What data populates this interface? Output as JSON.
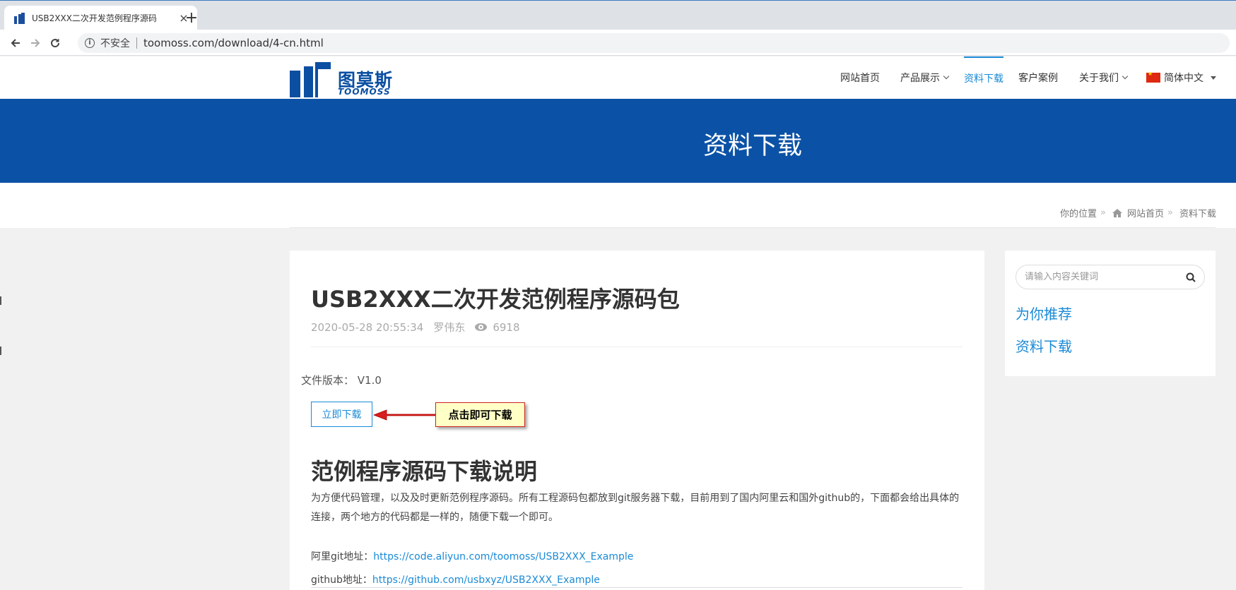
{
  "browser": {
    "tab_title": "USB2XXX二次开发范例程序源码",
    "tab_close": "×",
    "new_tab": "+",
    "secure_label": "不安全",
    "url": "toomoss.com/download/4-cn.html"
  },
  "site": {
    "logo_cn": "图莫斯",
    "logo_en": "TOOMOSS",
    "nav": [
      {
        "label": "网站首页"
      },
      {
        "label": "产品展示"
      },
      {
        "label": "资料下载"
      },
      {
        "label": "客户案例"
      },
      {
        "label": "关于我们"
      },
      {
        "label": "简体中文"
      }
    ],
    "accent_color": "#1a8ad6",
    "banner_color": "#0b52a6"
  },
  "banner": {
    "title": "资料下载"
  },
  "breadcrumb": {
    "prefix": "你的位置",
    "sep": "»",
    "home": "网站首页",
    "current": "资料下载"
  },
  "article": {
    "title": "USB2XXX二次开发范例程序源码包",
    "date": "2020-05-28 20:55:34",
    "author": "罗伟东",
    "views": "6918",
    "version_label": "文件版本：",
    "version": "V1.0",
    "download_button": "立即下载",
    "annotation": "点击即可下载",
    "section_title": "范例程序源码下载说明",
    "paragraph": "为方便代码管理，以及及时更新范例程序源码。所有工程源码包都放到git服务器下载，目前用到了国内阿里云和国外github的，下面都会给出具体的连接，两个地方的代码都是一样的，随便下载一个即可。",
    "aliyun_label": "阿里git地址：",
    "aliyun_url": "https://code.aliyun.com/toomoss/USB2XXX_Example",
    "github_label": "github地址：",
    "github_url": "https://github.com/usbxyz/USB2XXX_Example"
  },
  "sidebar": {
    "search_placeholder": "请输入内容关键词",
    "links": [
      {
        "label": "为你推荐"
      },
      {
        "label": "资料下载"
      }
    ]
  }
}
